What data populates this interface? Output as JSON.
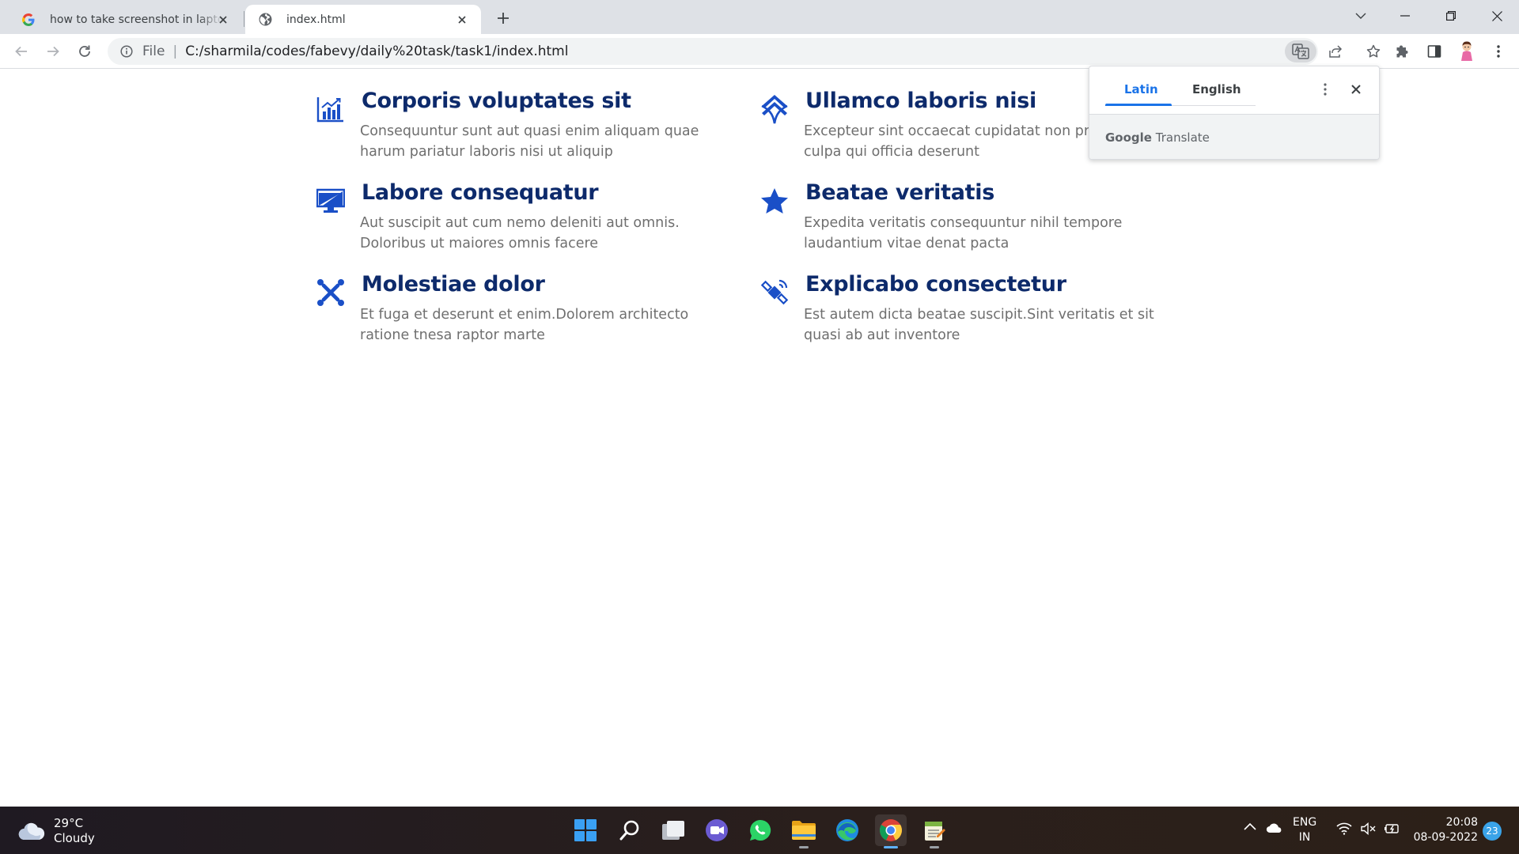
{
  "browser": {
    "tabs": [
      {
        "title": "how to take screenshot in laptop",
        "active": false,
        "favicon": "google-g-icon"
      },
      {
        "title": "index.html",
        "active": true,
        "favicon": "globe-icon"
      }
    ],
    "omnibox": {
      "scheme_label": "File",
      "url": "C:/sharmila/codes/fabevy/daily%20task/task1/index.html"
    }
  },
  "page": {
    "accent_color": "#0d2a6b",
    "icon_color": "#1a4fc7",
    "text_color": "#6f6f6f",
    "features": [
      {
        "icon": "bar-chart-icon",
        "title": "Corporis voluptates sit",
        "description": "Consequuntur sunt aut quasi enim aliquam quae harum pariatur laboris nisi ut aliquip"
      },
      {
        "icon": "layers-icon",
        "title": "Ullamco laboris nisi",
        "description": "Excepteur sint occaecat cupidatat non pr sunt in culpa qui officia deserunt"
      },
      {
        "icon": "monitor-icon",
        "title": "Labore consequatur",
        "description": "Aut suscipit aut cum nemo deleniti aut omnis. Doloribus ut maiores omnis facere"
      },
      {
        "icon": "star-icon",
        "title": "Beatae veritatis",
        "description": "Expedita veritatis consequuntur nihil tempore laudantium vitae denat pacta"
      },
      {
        "icon": "joomla-icon",
        "title": "Molestiae dolor",
        "description": "Et fuga et deserunt et enim.Dolorem architecto ratione tnesa raptor marte"
      },
      {
        "icon": "satellite-icon",
        "title": "Explicabo consectetur",
        "description": "Est autem dicta beatae suscipit.Sint veritatis et sit quasi ab aut inventore"
      }
    ]
  },
  "translate_popup": {
    "source_language": "Latin",
    "target_language": "English",
    "brand_prefix": "Google",
    "brand_suffix": "Translate"
  },
  "taskbar": {
    "weather": {
      "temperature": "29°C",
      "condition": "Cloudy"
    },
    "language": {
      "line1": "ENG",
      "line2": "IN"
    },
    "clock": {
      "time": "20:08",
      "date": "08-09-2022"
    },
    "notification_count": "23",
    "apps": [
      "start-icon",
      "search-icon",
      "task-view-icon",
      "teams-chat-icon",
      "whatsapp-icon",
      "file-explorer-icon",
      "edge-icon",
      "chrome-icon",
      "notepad-app-icon"
    ]
  }
}
